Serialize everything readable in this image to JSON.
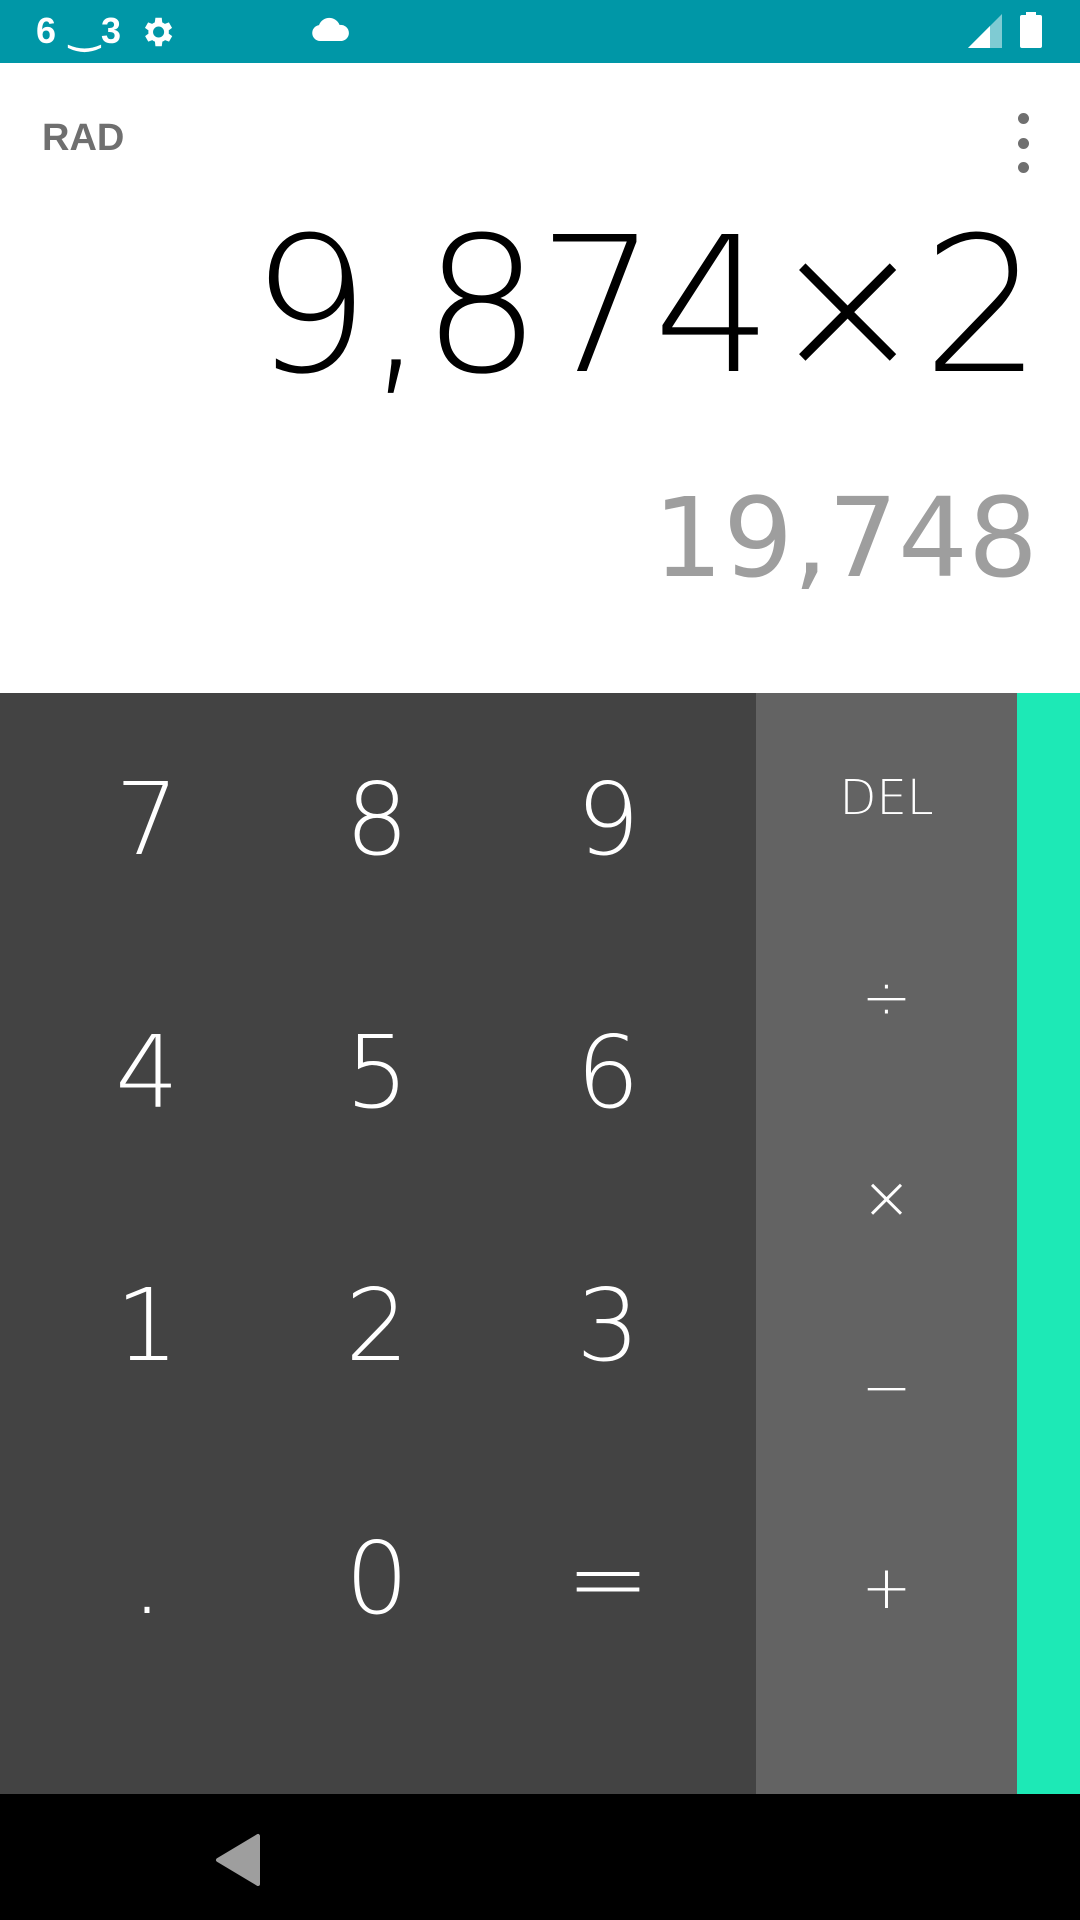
{
  "status_bar": {
    "time": "6 ‿3",
    "icons": [
      "settings-icon",
      "cloud-icon",
      "signal-icon",
      "battery-icon"
    ],
    "background": "#0097a7"
  },
  "display": {
    "angle_mode": "RAD",
    "formula": "9,874×2",
    "result": "19,748"
  },
  "numpad": {
    "row1": [
      "7",
      "8",
      "9"
    ],
    "row2": [
      "4",
      "5",
      "6"
    ],
    "row3": [
      "1",
      "2",
      "3"
    ],
    "row4": [
      ".",
      "0",
      "="
    ]
  },
  "operators": {
    "del": "DEL",
    "divide": "÷",
    "multiply": "×",
    "subtract": "−",
    "add": "+"
  },
  "colors": {
    "numpad_bg": "#434343",
    "operator_bg": "#636363",
    "advanced_accent": "#1de9b6"
  },
  "nav": {
    "icons": [
      "back-icon"
    ]
  }
}
